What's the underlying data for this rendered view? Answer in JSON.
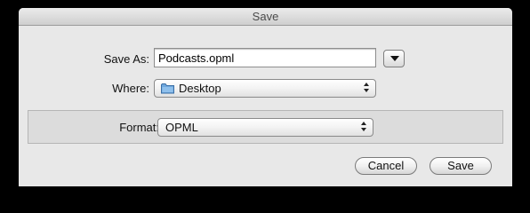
{
  "window": {
    "title": "Save"
  },
  "form": {
    "save_as_label": "Save As:",
    "save_as_value": "Podcasts.opml",
    "where_label": "Where:",
    "where_value": "Desktop",
    "format_label": "Format:",
    "format_value": "OPML"
  },
  "buttons": {
    "cancel_label": "Cancel",
    "save_label": "Save"
  },
  "icons": {
    "folder": "folder-icon",
    "disclosure": "chevron-down-icon",
    "popup_arrows": "updown-arrows-icon"
  },
  "colors": {
    "window_bg": "#e8e8e8",
    "accessory_bg": "#dcdcdc",
    "folder_blue": "#5d9bd6"
  }
}
